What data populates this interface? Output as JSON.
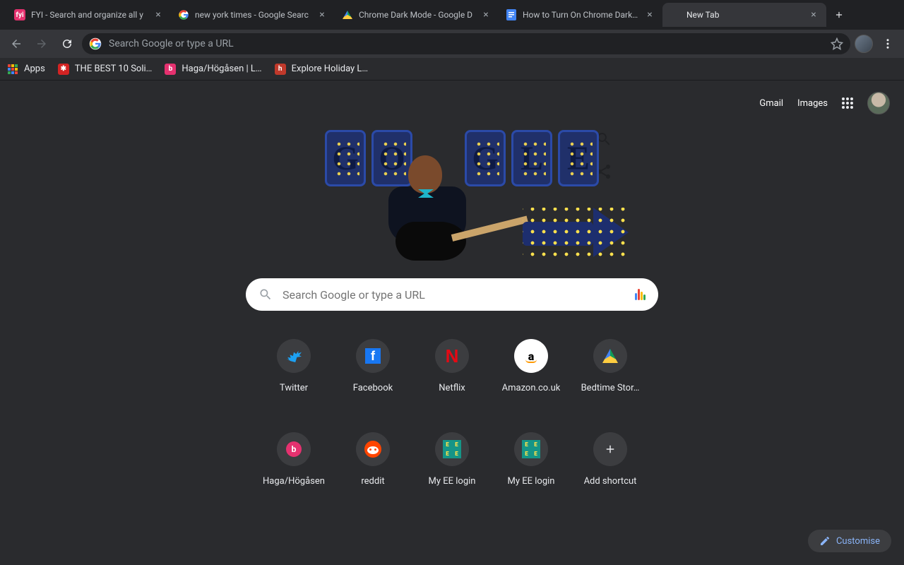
{
  "tabs": [
    {
      "title": "FYI - Search and organize all y",
      "favicon": "fyi",
      "active": false
    },
    {
      "title": "new york times - Google Searc",
      "favicon": "g",
      "active": false
    },
    {
      "title": "Chrome Dark Mode - Google D",
      "favicon": "drive",
      "active": false
    },
    {
      "title": "How to Turn On Chrome Dark M",
      "favicon": "docs",
      "active": false
    },
    {
      "title": "New Tab",
      "favicon": "newtab",
      "active": true
    }
  ],
  "omnibox": {
    "placeholder": "Search Google or type a URL"
  },
  "bookmarks": [
    {
      "label": "Apps",
      "icon": "apps"
    },
    {
      "label": "THE BEST 10 Soli…",
      "icon": "yelp"
    },
    {
      "label": "Haga/Högåsen | L…",
      "icon": "b"
    },
    {
      "label": "Explore Holiday L…",
      "icon": "h"
    }
  ],
  "top_links": {
    "gmail": "Gmail",
    "images": "Images"
  },
  "searchbox": {
    "placeholder": "Search Google or type a URL"
  },
  "shortcuts": [
    {
      "label": "Twitter",
      "icon": "twitter"
    },
    {
      "label": "Facebook",
      "icon": "fb"
    },
    {
      "label": "Netflix",
      "icon": "netflix"
    },
    {
      "label": "Amazon.co.uk",
      "icon": "amazon"
    },
    {
      "label": "Bedtime Stor…",
      "icon": "drive"
    },
    {
      "label": "Haga/Högåsen",
      "icon": "b"
    },
    {
      "label": "reddit",
      "icon": "reddit"
    },
    {
      "label": "My EE login",
      "icon": "ee"
    },
    {
      "label": "My EE login",
      "icon": "ee"
    },
    {
      "label": "Add shortcut",
      "icon": "plus"
    }
  ],
  "customise_label": "Customise"
}
